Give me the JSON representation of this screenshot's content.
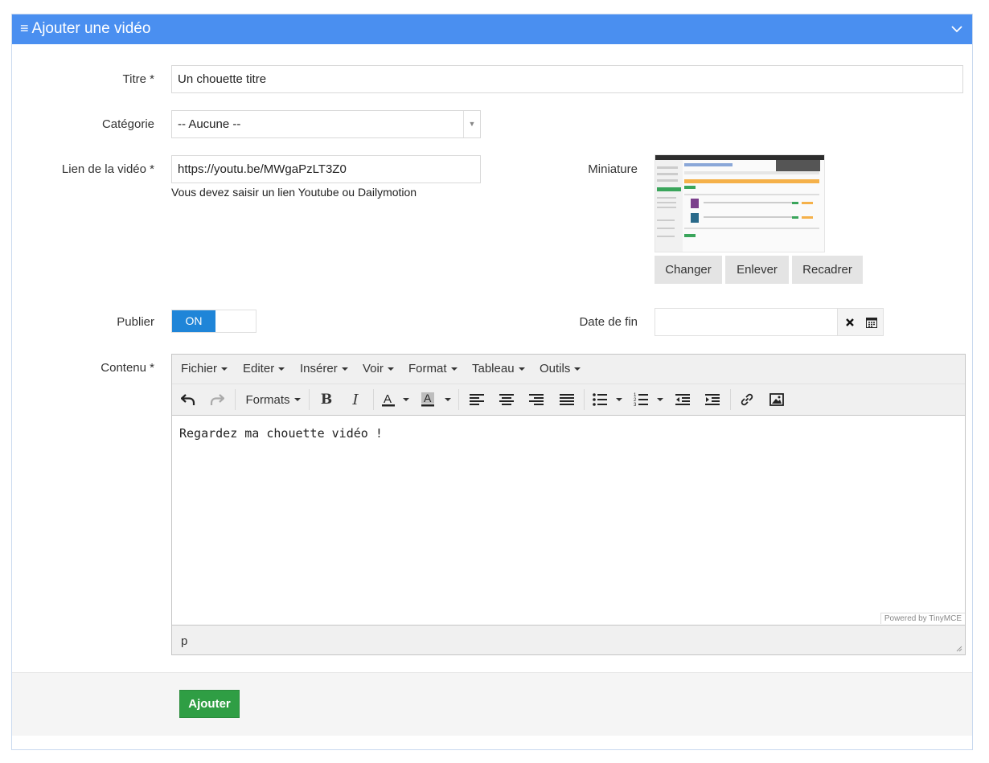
{
  "header": {
    "title": "Ajouter une vidéo"
  },
  "form": {
    "title_label": "Titre *",
    "title_value": "Un chouette titre",
    "category_label": "Catégorie",
    "category_value": "-- Aucune --",
    "video_link_label": "Lien de la vidéo *",
    "video_link_value": "https://youtu.be/MWgaPzLT3Z0",
    "video_link_help": "Vous devez saisir un lien Youtube ou Dailymotion",
    "thumbnail_label": "Miniature",
    "thumbnail_buttons": {
      "change": "Changer",
      "remove": "Enlever",
      "crop": "Recadrer"
    },
    "publish_label": "Publier",
    "publish_state": "ON",
    "end_date_label": "Date de fin",
    "end_date_value": "",
    "content_label": "Contenu *"
  },
  "editor": {
    "menu": [
      "Fichier",
      "Editer",
      "Insérer",
      "Voir",
      "Format",
      "Tableau",
      "Outils"
    ],
    "formats_label": "Formats",
    "content": "Regardez ma chouette vidéo !",
    "powered_by": "Powered by TinyMCE",
    "path": "p"
  },
  "footer": {
    "submit_label": "Ajouter"
  },
  "colors": {
    "header": "#4a8ff0",
    "toggle_on": "#1f85d8",
    "submit": "#2f9e44"
  }
}
